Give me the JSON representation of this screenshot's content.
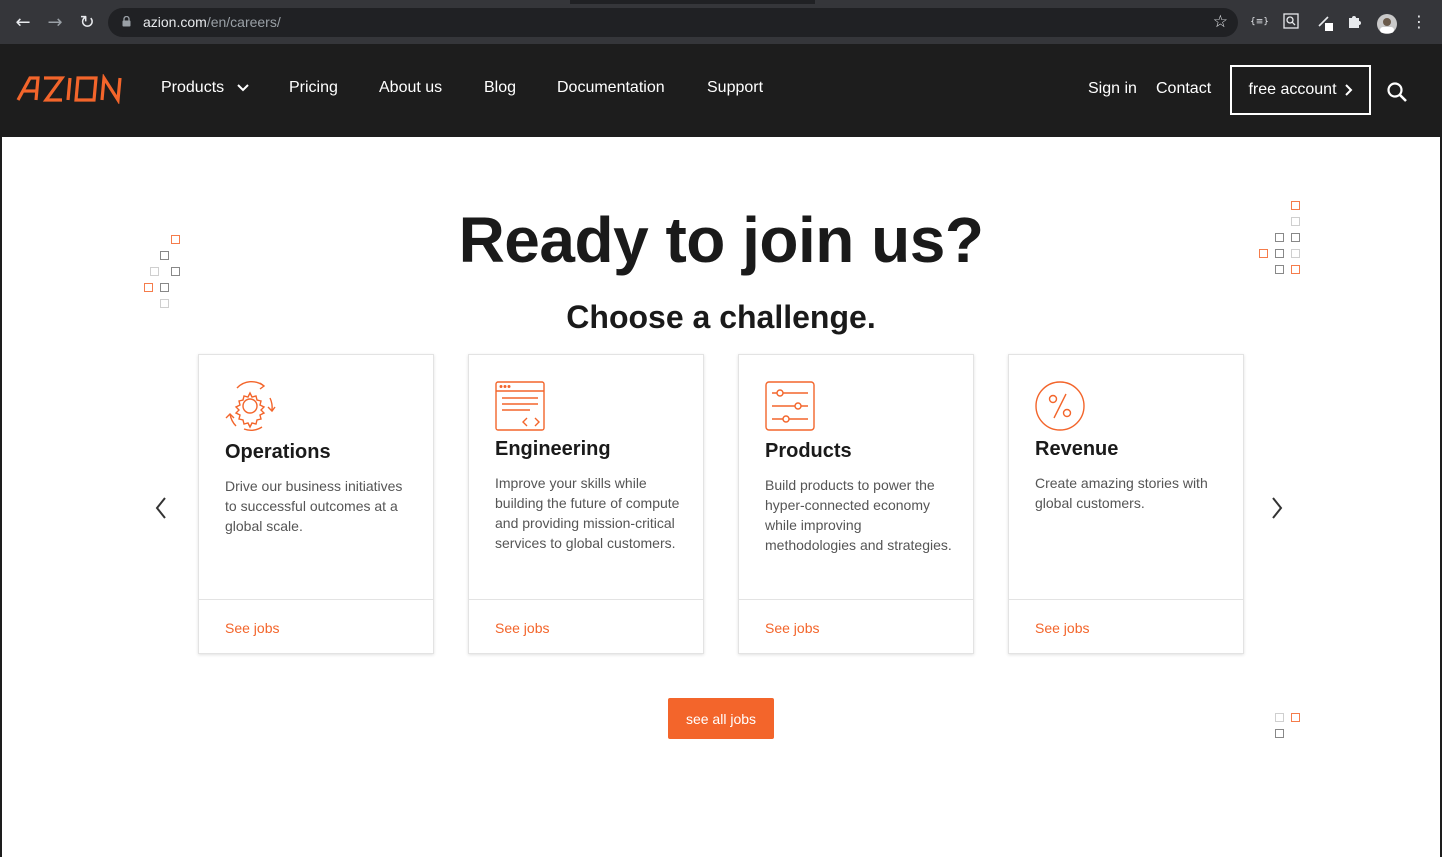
{
  "browser": {
    "url_host": "azion.com",
    "url_path": "/en/careers/",
    "back_icon": "arrow-left-icon",
    "forward_icon": "arrow-right-icon",
    "reload_icon": "reload-icon"
  },
  "header": {
    "logo_text": "AZION",
    "nav": [
      "Products",
      "Pricing",
      "About us",
      "Blog",
      "Documentation",
      "Support"
    ],
    "sign_in": "Sign in",
    "contact": "Contact",
    "free_account": "free account"
  },
  "hero": {
    "headline_regular": "Ready to ",
    "headline_bold": "join us?",
    "subheading": "Choose a challenge."
  },
  "cards": [
    {
      "icon": "gear-cycle-icon",
      "title": "Operations",
      "description": "Drive our business initiatives to successful outcomes at a global scale.",
      "link": "See jobs"
    },
    {
      "icon": "code-window-icon",
      "title": "Engineering",
      "description": "Improve your skills while building the future of compute and providing mission-critical services to global customers.",
      "link": "See jobs"
    },
    {
      "icon": "sliders-icon",
      "title": "Products",
      "description": "Build products to power the hyper-connected economy while improving methodologies and strategies.",
      "link": "See jobs"
    },
    {
      "icon": "percent-icon",
      "title": "Revenue",
      "description": "Create amazing stories with global customers.",
      "link": "See jobs"
    }
  ],
  "cta": {
    "see_all": "see all jobs"
  },
  "colors": {
    "brand_orange": "#f3652b",
    "header_bg": "#1d1d1d"
  }
}
